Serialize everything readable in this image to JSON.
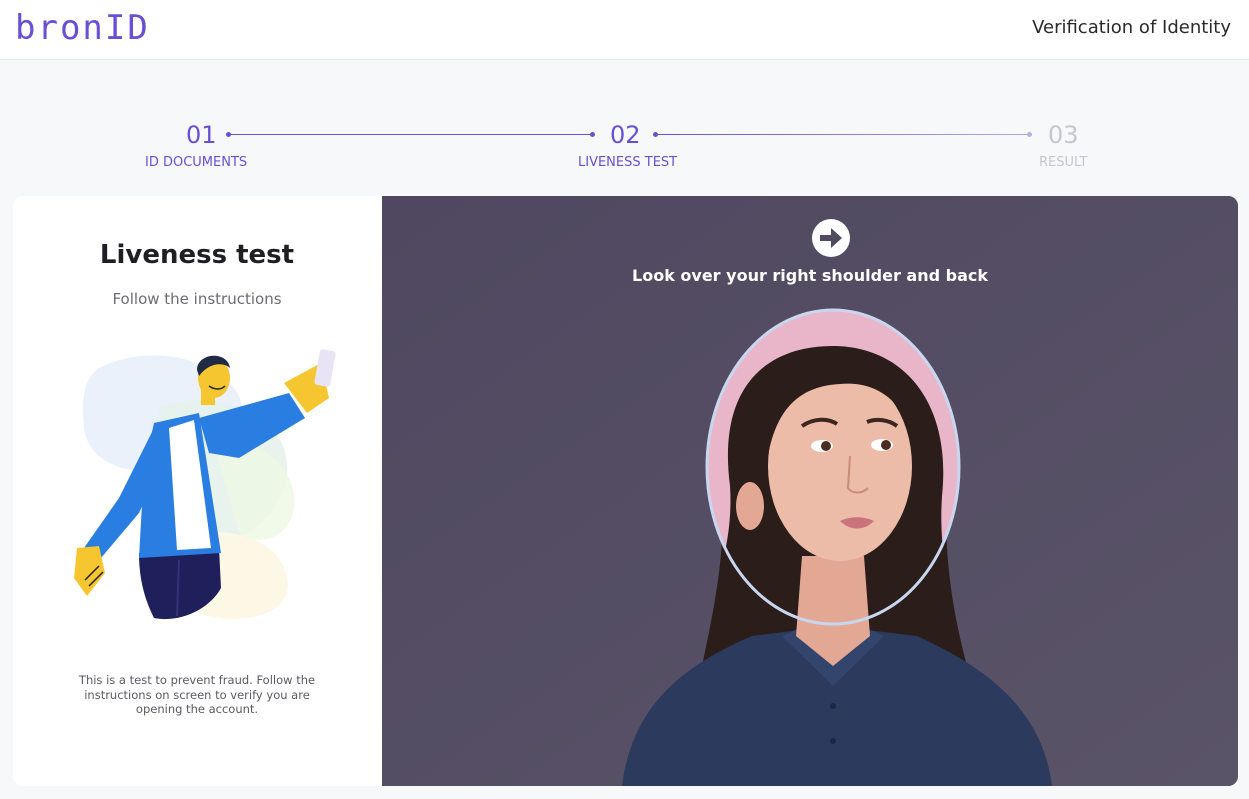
{
  "header": {
    "logo_text": "bronID",
    "title": "Verification of Identity"
  },
  "stepper": {
    "steps": [
      {
        "number": "01",
        "label": "ID DOCUMENTS",
        "state": "complete"
      },
      {
        "number": "02",
        "label": "LIVENESS TEST",
        "state": "active"
      },
      {
        "number": "03",
        "label": "RESULT",
        "state": "pending"
      }
    ]
  },
  "info_card": {
    "title": "Liveness test",
    "subtitle": "Follow the instructions",
    "illustration": "person-taking-selfie-illustration",
    "note": "This is a test to prevent fraud. Follow the instructions on screen to verify you are opening the account."
  },
  "camera": {
    "instruction_icon": "arrow-right-circle-icon",
    "instruction": "Look over your right shoulder and back",
    "overlay": "face-oval-guide"
  },
  "colors": {
    "accent": "#6a4fd6",
    "inactive": "#c6c6cf",
    "camera_bg": "#524b60",
    "face_oval_border": "#c9d6f0"
  }
}
